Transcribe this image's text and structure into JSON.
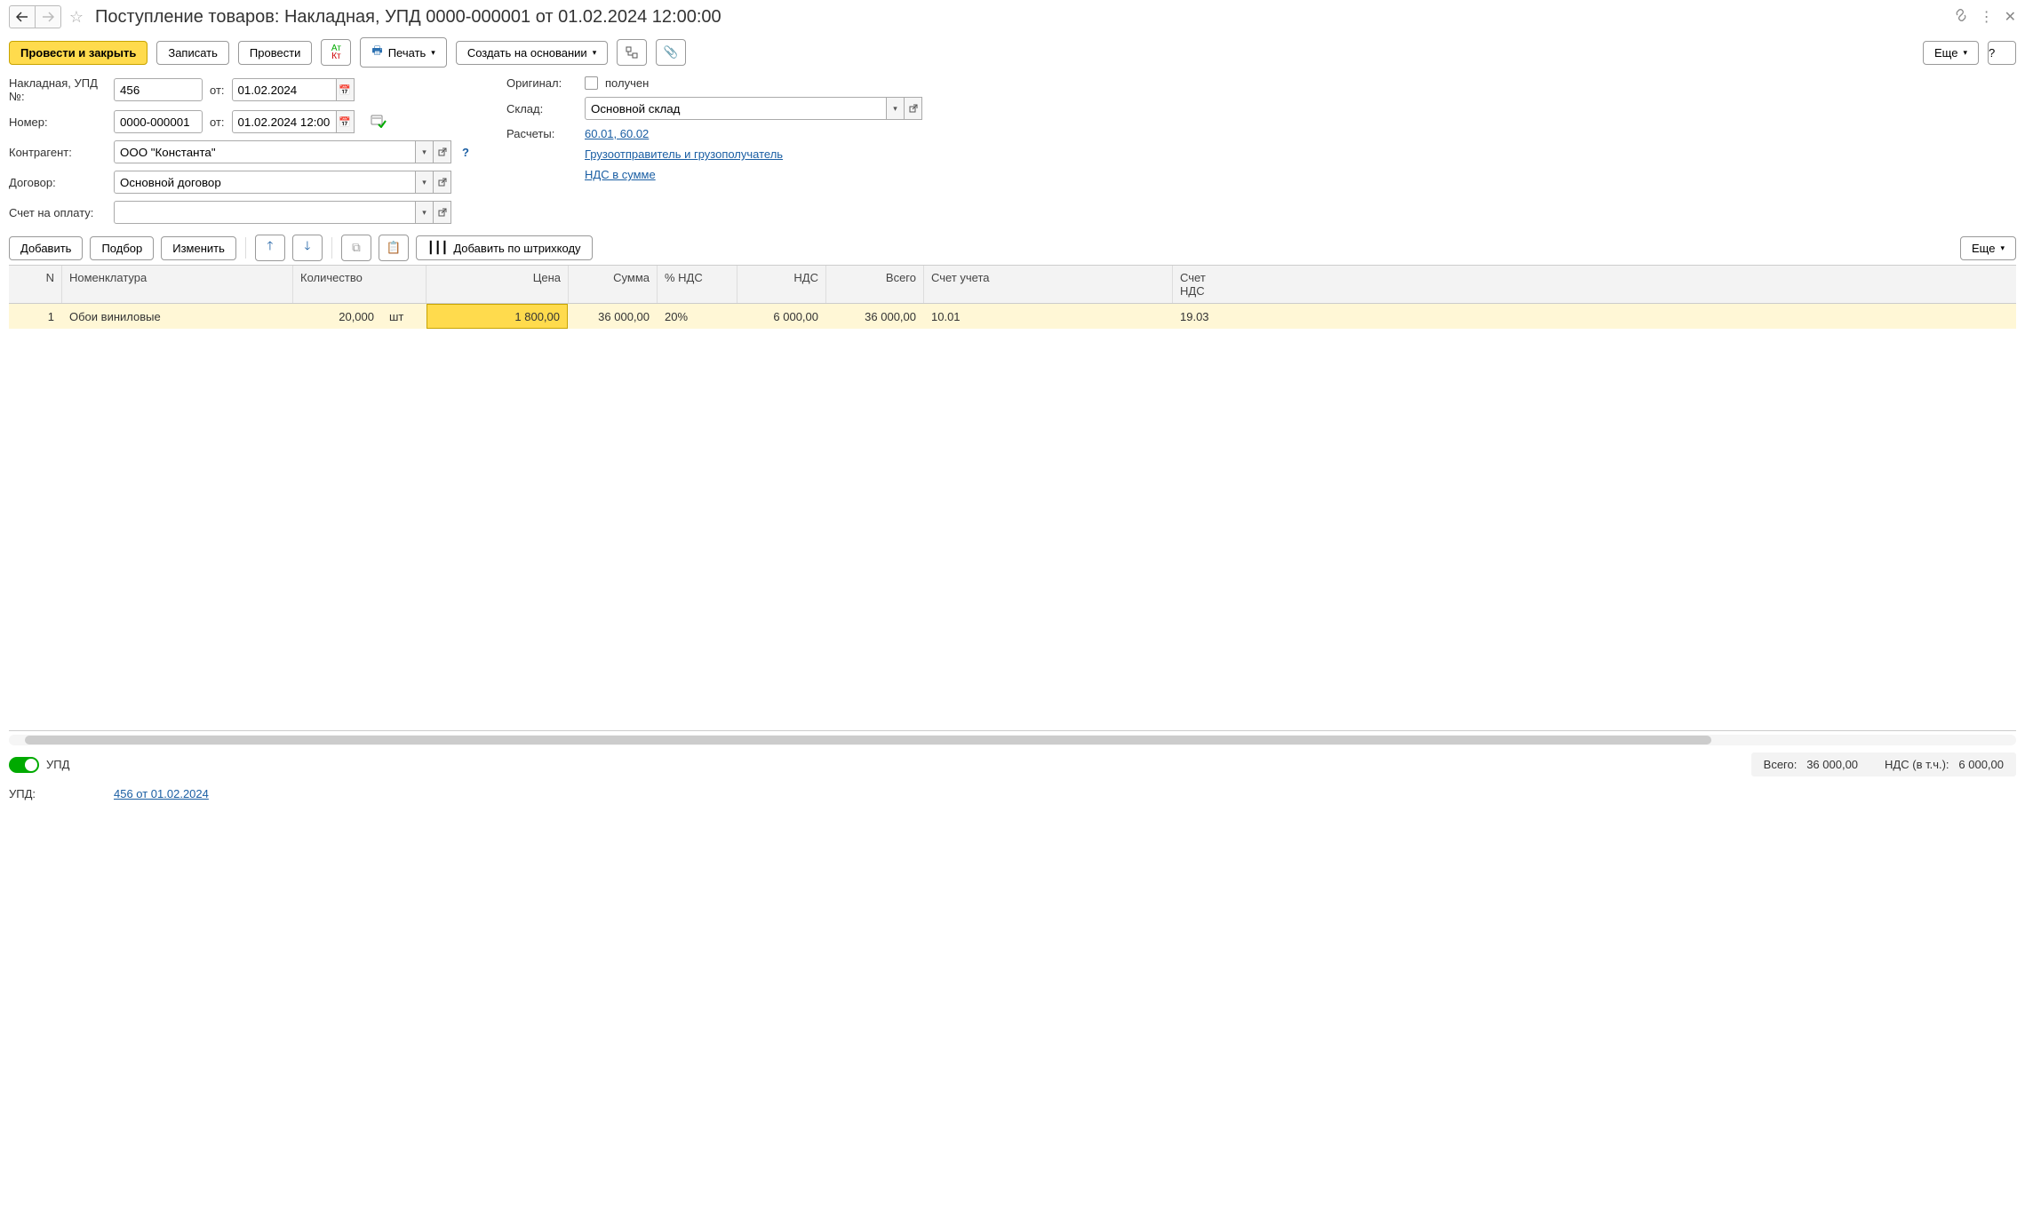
{
  "title": "Поступление товаров: Накладная, УПД 0000-000001 от 01.02.2024 12:00:00",
  "toolbar": {
    "post_and_close": "Провести и закрыть",
    "save": "Записать",
    "post": "Провести",
    "print": "Печать",
    "create_based": "Создать на основании",
    "more": "Еще",
    "help": "?"
  },
  "form": {
    "invoice_label": "Накладная, УПД №:",
    "invoice_value": "456",
    "from_label": "от:",
    "invoice_date": "01.02.2024",
    "number_label": "Номер:",
    "number_value": "0000-000001",
    "doc_date": "01.02.2024 12:00:00",
    "counterparty_label": "Контрагент:",
    "counterparty_value": "ООО \"Константа\"",
    "contract_label": "Договор:",
    "contract_value": "Основной договор",
    "payment_invoice_label": "Счет на оплату:",
    "payment_invoice_value": "",
    "original_label": "Оригинал:",
    "received_label": "получен",
    "warehouse_label": "Склад:",
    "warehouse_value": "Основной склад",
    "settlements_label": "Расчеты:",
    "settlements_link": "60.01, 60.02",
    "shipper_link": "Грузоотправитель и грузополучатель",
    "vat_link": "НДС в сумме"
  },
  "table_toolbar": {
    "add": "Добавить",
    "pick": "Подбор",
    "edit": "Изменить",
    "add_barcode": "Добавить по штрихкоду",
    "more": "Еще"
  },
  "columns": {
    "n": "N",
    "nom": "Номенклатура",
    "qty": "Количество",
    "price": "Цена",
    "sum": "Сумма",
    "vatpct": "% НДС",
    "nds": "НДС",
    "total": "Всего",
    "acct": "Счет учета",
    "ndsacct": "Счет НДС"
  },
  "rows": [
    {
      "n": "1",
      "nom": "Обои виниловые",
      "qty": "20,000",
      "unit": "шт",
      "price": "1 800,00",
      "sum": "36 000,00",
      "vatpct": "20%",
      "nds": "6 000,00",
      "total": "36 000,00",
      "acct": "10.01",
      "ndsacct": "19.03"
    }
  ],
  "footer": {
    "upd_toggle_label": "УПД",
    "totals_label": "Всего:",
    "totals_value": "36 000,00",
    "nds_label": "НДС (в т.ч.):",
    "nds_value": "6 000,00",
    "upd_label": "УПД:",
    "upd_link": "456 от 01.02.2024"
  }
}
